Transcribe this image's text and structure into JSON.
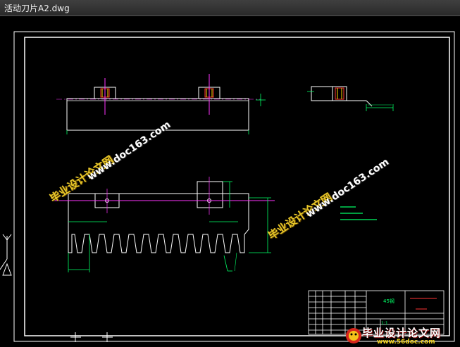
{
  "window": {
    "title": "活动刀片A2.dwg"
  },
  "title_block": {
    "material": "45钢",
    "scale": "1:1"
  },
  "watermark": {
    "site_cn": "毕业设计论文网",
    "site_url": "www.doc163.com"
  },
  "logo": {
    "name_cn": "毕业设计论文网",
    "url": "www.56doc.com"
  },
  "colors": {
    "background": "#000000",
    "geometry": "#ffffff",
    "dimension": "#00ff66",
    "centerline": "#ff33ff",
    "watermark": "#e7c72a"
  }
}
